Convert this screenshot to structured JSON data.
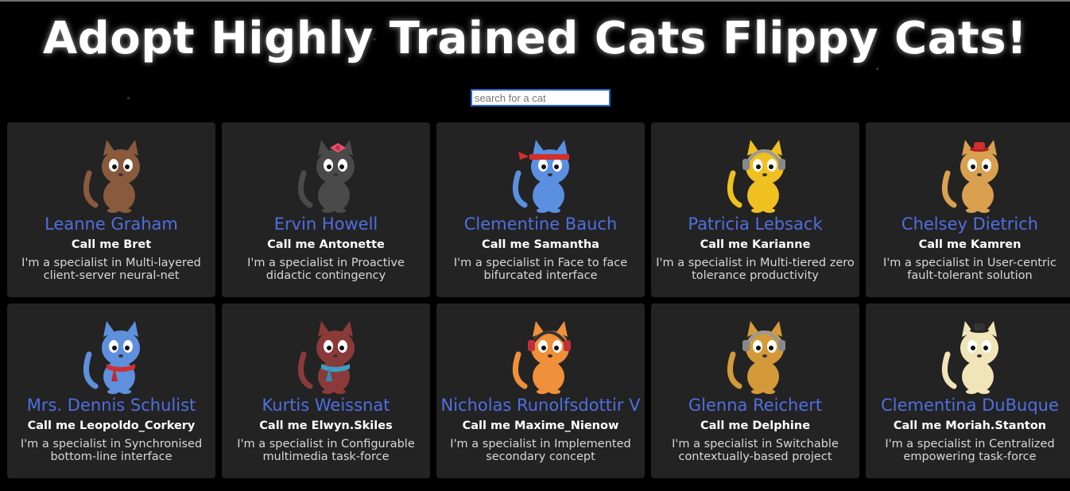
{
  "title": "Adopt Highly Trained Cats Flippy Cats!",
  "search": {
    "placeholder": "search for a cat",
    "value": ""
  },
  "cats": [
    {
      "name": "Leanne Graham",
      "username": "Call me Bret",
      "bio": "I'm a specialist in Multi-layered client-server neural-net",
      "color": "#8a5a3c",
      "accessory": "none"
    },
    {
      "name": "Ervin Howell",
      "username": "Call me Antonette",
      "bio": "I'm a specialist in Proactive didactic contingency",
      "color": "#4a4a4a",
      "accessory": "bow"
    },
    {
      "name": "Clementine Bauch",
      "username": "Call me Samantha",
      "bio": "I'm a specialist in Face to face bifurcated interface",
      "color": "#5b8fe0",
      "accessory": "headband"
    },
    {
      "name": "Patricia Lebsack",
      "username": "Call me Karianne",
      "bio": "I'm a specialist in Multi-tiered zero tolerance productivity",
      "color": "#f0c020",
      "accessory": "headphones"
    },
    {
      "name": "Chelsey Dietrich",
      "username": "Call me Kamren",
      "bio": "I'm a specialist in User-centric fault-tolerant solution",
      "color": "#d9a050",
      "accessory": "hat"
    },
    {
      "name": "Mrs. Dennis Schulist",
      "username": "Call me Leopoldo_Corkery",
      "bio": "I'm a specialist in Synchronised bottom-line interface",
      "color": "#5f90de",
      "accessory": "scarf-red"
    },
    {
      "name": "Kurtis Weissnat",
      "username": "Call me Elwyn.Skiles",
      "bio": "I'm a specialist in Configurable multimedia task-force",
      "color": "#8b3a3a",
      "accessory": "scarf-blue"
    },
    {
      "name": "Nicholas Runolfsdottir V",
      "username": "Call me Maxime_Nienow",
      "bio": "I'm a specialist in Implemented secondary concept",
      "color": "#f0903a",
      "accessory": "headphones-red"
    },
    {
      "name": "Glenna Reichert",
      "username": "Call me Delphine",
      "bio": "I'm a specialist in Switchable contextually-based project",
      "color": "#d49a3a",
      "accessory": "headphones"
    },
    {
      "name": "Clementina DuBuque",
      "username": "Call me Moriah.Stanton",
      "bio": "I'm a specialist in Centralized empowering task-force",
      "color": "#f0e4b8",
      "accessory": "hat-black"
    }
  ]
}
